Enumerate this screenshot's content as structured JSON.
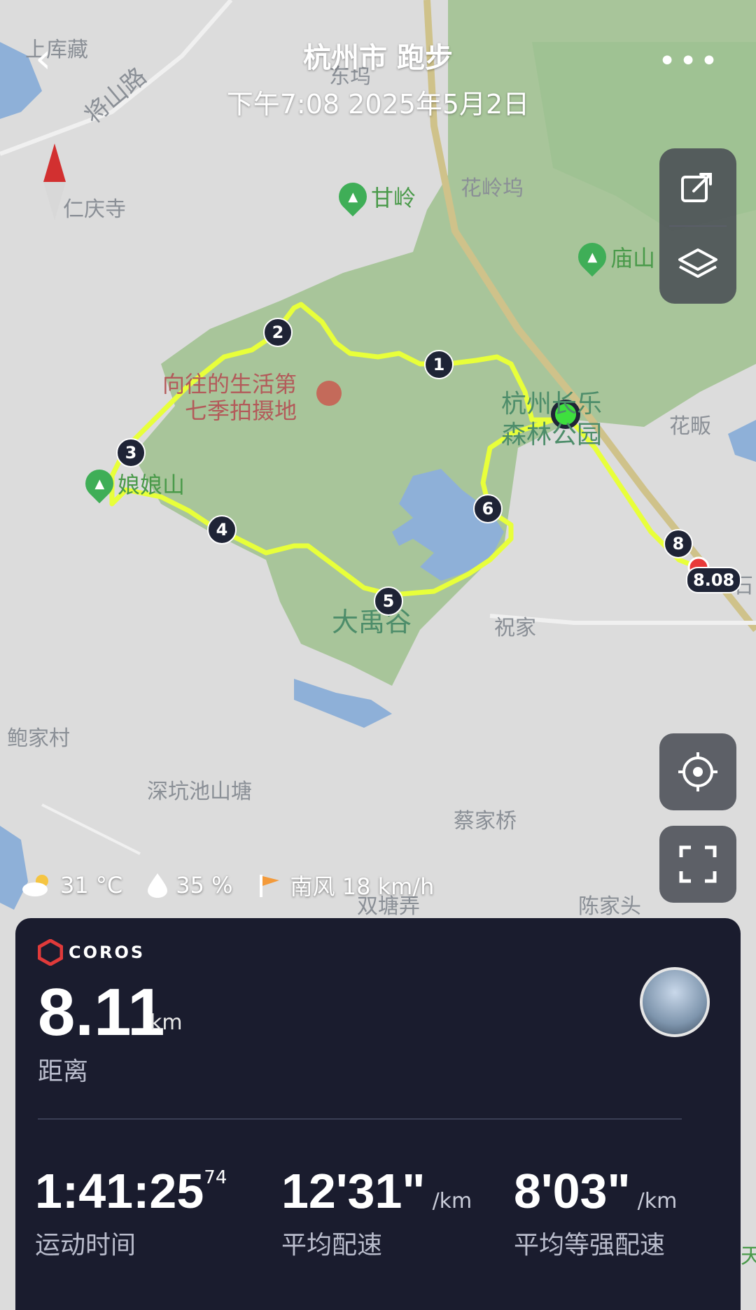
{
  "header": {
    "title": "杭州市 跑步",
    "subtitle": "下午7:08 2025年5月2日",
    "more_label": "•••"
  },
  "map": {
    "place_labels": [
      "上库藏",
      "将山路",
      "东坞",
      "仁庆寺",
      "花岭坞",
      "花畈",
      "祝家",
      "鲍家村",
      "深坑池山塘",
      "蔡家桥",
      "双塘弄",
      "陈家头",
      "石",
      "天"
    ],
    "pois": [
      {
        "name": "甘岭",
        "icon": "mountain-icon"
      },
      {
        "name": "庙山",
        "icon": "mountain-icon"
      },
      {
        "name": "娘娘山",
        "icon": "mountain-icon"
      }
    ],
    "landmark_name_line1": "向往的生活第",
    "landmark_name_line2": "七季拍摄地",
    "park_name_line1": "杭州长乐",
    "park_name_line2": "森林公园",
    "valley_name": "大禹谷",
    "km_markers": [
      "1",
      "2",
      "3",
      "4",
      "5",
      "6",
      "8"
    ],
    "end_label": "8.08",
    "colors": {
      "route": "#e8ff3a",
      "green_area": "#a8c59a",
      "water": "#8eb0d8",
      "road": "#cfc28a",
      "start": "#3ee03e",
      "end": "#e83a3a"
    }
  },
  "weather": {
    "temp": "31 °C",
    "humidity": "35 %",
    "wind": "南风 18 km/h"
  },
  "summary": {
    "brand": "COROS",
    "distance_value": "8.11",
    "distance_unit": "km",
    "distance_label": "距离",
    "stats": [
      {
        "value": "1:41:25",
        "sup": "74",
        "unit": "",
        "label": "运动时间"
      },
      {
        "value": "12'31\"",
        "sup": "",
        "unit": "/km",
        "label": "平均配速"
      },
      {
        "value": "8'03\"",
        "sup": "",
        "unit": "/km",
        "label": "平均等强配速"
      }
    ]
  }
}
